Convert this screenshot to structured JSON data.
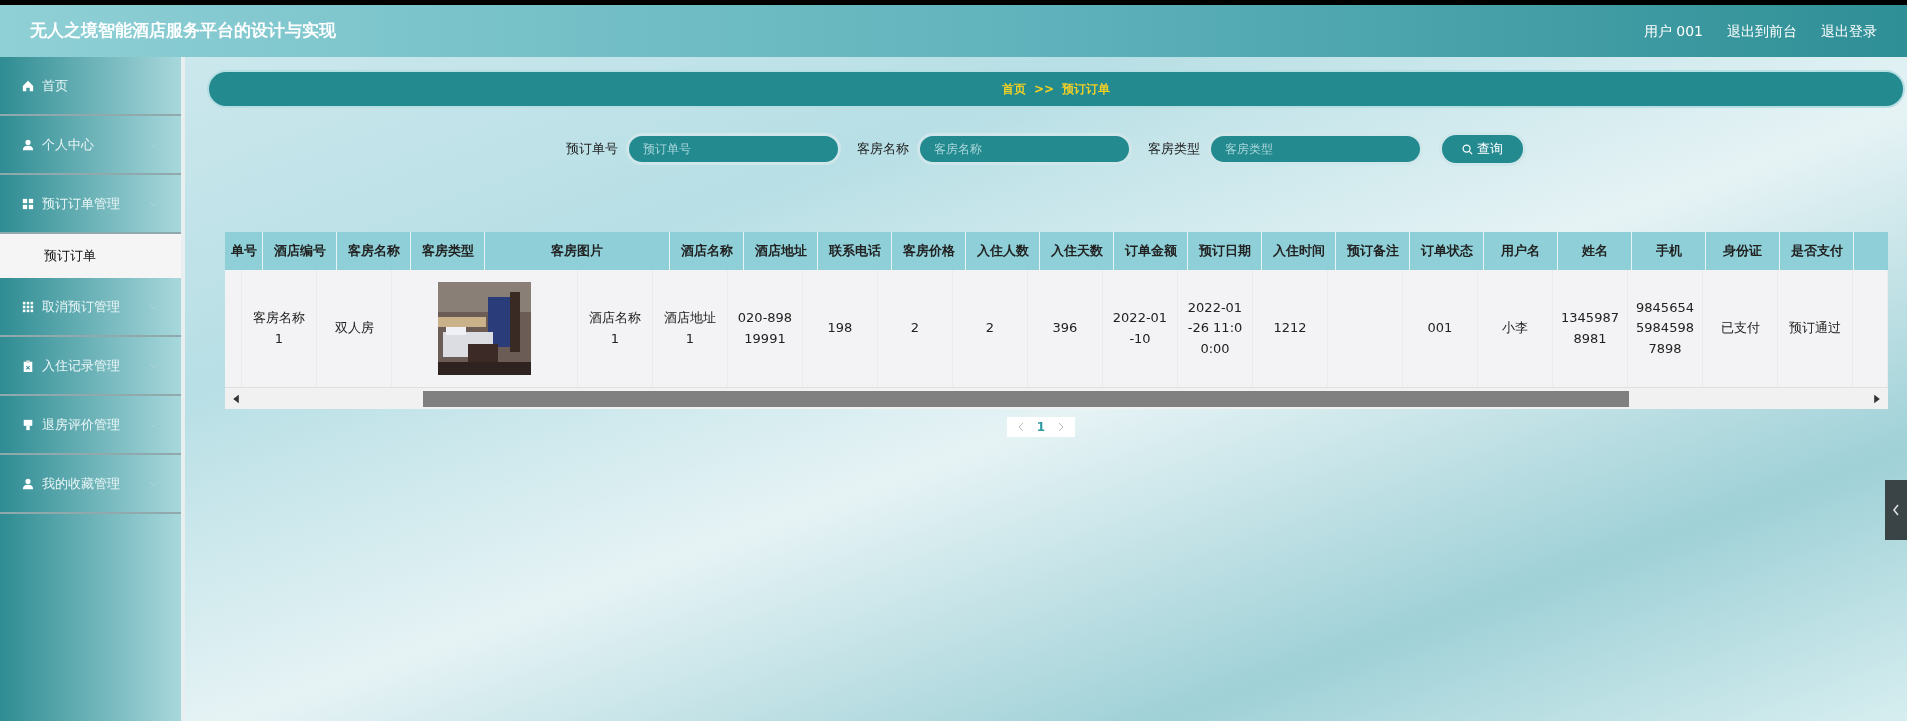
{
  "header": {
    "title": "无人之境智能酒店服务平台的设计与实现",
    "links": [
      "用户 001",
      "退出到前台",
      "退出登录"
    ]
  },
  "sidebar": {
    "items": [
      {
        "label": "首页"
      },
      {
        "label": "个人中心"
      },
      {
        "label": "预订订单管理",
        "children": [
          {
            "label": "预订订单",
            "selected": true
          }
        ]
      },
      {
        "label": "取消预订管理"
      },
      {
        "label": "入住记录管理"
      },
      {
        "label": "退房评价管理"
      },
      {
        "label": "我的收藏管理"
      }
    ]
  },
  "breadcrumb": [
    "首页",
    ">>",
    "预订订单"
  ],
  "search": {
    "fields": [
      {
        "label": "预订单号",
        "placeholder": "预订单号"
      },
      {
        "label": "客房名称",
        "placeholder": "客房名称"
      },
      {
        "label": "客房类型",
        "placeholder": "客房类型"
      }
    ],
    "button": "查询"
  },
  "table": {
    "columns": [
      "单号",
      "酒店编号",
      "客房名称",
      "客房类型",
      "客房图片",
      "酒店名称",
      "酒店地址",
      "联系电话",
      "客房价格",
      "入住人数",
      "入住天数",
      "订单金额",
      "预订日期",
      "入住时间",
      "预订备注",
      "订单状态",
      "用户名",
      "姓名",
      "手机",
      "身份证",
      "是否支付"
    ],
    "rows": [
      {
        "cells": [
          {
            "kind": "blank"
          },
          {
            "kind": "text",
            "text": "客房名称1"
          },
          {
            "kind": "text",
            "text": "双人房"
          },
          {
            "kind": "picture"
          },
          {
            "kind": "text",
            "text": "酒店名称1"
          },
          {
            "kind": "text",
            "text": "酒店地址1"
          },
          {
            "kind": "text",
            "text": "020-89819991"
          },
          {
            "kind": "text",
            "text": "198"
          },
          {
            "kind": "text",
            "text": "2"
          },
          {
            "kind": "text",
            "text": "2"
          },
          {
            "kind": "text",
            "text": "396"
          },
          {
            "kind": "text",
            "text": "2022-01-10"
          },
          {
            "kind": "text",
            "text": "2022-01-26 11:00:00"
          },
          {
            "kind": "text",
            "text": "1212"
          },
          {
            "kind": "blank"
          },
          {
            "kind": "text",
            "text": "001"
          },
          {
            "kind": "text",
            "text": "小李"
          },
          {
            "kind": "text",
            "text": "13459878981"
          },
          {
            "kind": "text",
            "text": "984565459845987898"
          },
          {
            "kind": "text",
            "text": "已支付"
          },
          {
            "kind": "text",
            "text": "预订通过"
          },
          {
            "kind": "blank"
          }
        ]
      }
    ]
  },
  "pagination": {
    "pages": [
      {
        "label": "1",
        "selected": true
      }
    ]
  }
}
